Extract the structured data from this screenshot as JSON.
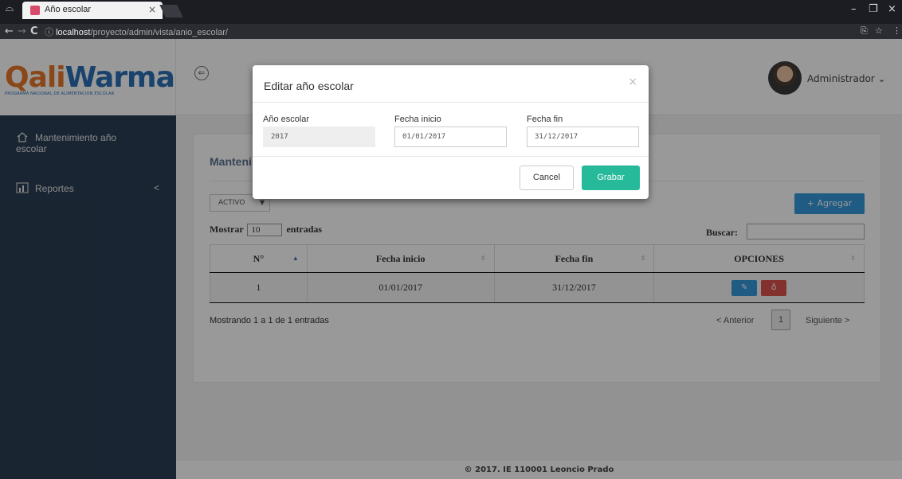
{
  "browser": {
    "tab_title": "Año escolar",
    "tab_close": "×",
    "url_host": "localhost",
    "url_path": "/proyecto/admin/vista/anio_escolar/",
    "info_icon": "ⓘ",
    "back": "←",
    "forward": "→",
    "reload": "C",
    "minimize": "–",
    "maximize": "❐",
    "close": "×",
    "menu": "⋮",
    "star": "☆",
    "translate": "⎘"
  },
  "header": {
    "logo_q": "Qali",
    "logo_w": "Warma",
    "logo_sub": "PROGRAMA NACIONAL DE ALIMENTACION ESCOLAR",
    "back_icon": "⇐",
    "user": "Administrador ⌄"
  },
  "sidebar": {
    "items": [
      {
        "label": "Mantenimiento año",
        "label2": "escolar"
      },
      {
        "label": "Reportes",
        "arrow": "<"
      }
    ]
  },
  "panel": {
    "title": "Manteni",
    "status_select": "ACTIVO",
    "status_arrow": "▼",
    "add_button": "+ Agregar",
    "show_prefix": "Mostrar",
    "show_value": "10",
    "show_suffix": "entradas",
    "search_label": "Buscar:",
    "table": {
      "headers": [
        "N°",
        "Fecha inicio",
        "Fecha fin",
        "OPCIONES"
      ],
      "rows": [
        {
          "n": "1",
          "inicio": "01/01/2017",
          "fin": "31/12/2017"
        }
      ]
    },
    "info": "Mostrando 1 a 1 de 1 entradas",
    "prev": "< Anterior",
    "page": "1",
    "next": "Siguiente >"
  },
  "modal": {
    "title": "Editar año escolar",
    "close": "×",
    "fields": [
      {
        "label": "Año escolar",
        "value": "2017"
      },
      {
        "label": "Fecha inicio",
        "value": "01/01/2017"
      },
      {
        "label": "Fecha fin",
        "value": "31/12/2017"
      }
    ],
    "cancel": "Cancel",
    "save": "Grabar"
  },
  "footer": "© 2017. IE 110001 Leoncio Prado"
}
